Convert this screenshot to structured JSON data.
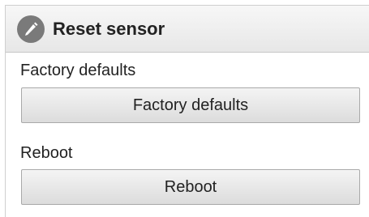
{
  "panel": {
    "title": "Reset sensor",
    "icon": "pencil-icon"
  },
  "factory": {
    "label": "Factory defaults",
    "button_label": "Factory defaults"
  },
  "reboot": {
    "label": "Reboot",
    "button_label": "Reboot"
  },
  "colors": {
    "header_bg": "#ececec",
    "icon_bg": "#7a7a7a",
    "button_bg": "#e6e6e6",
    "text": "#222222"
  }
}
